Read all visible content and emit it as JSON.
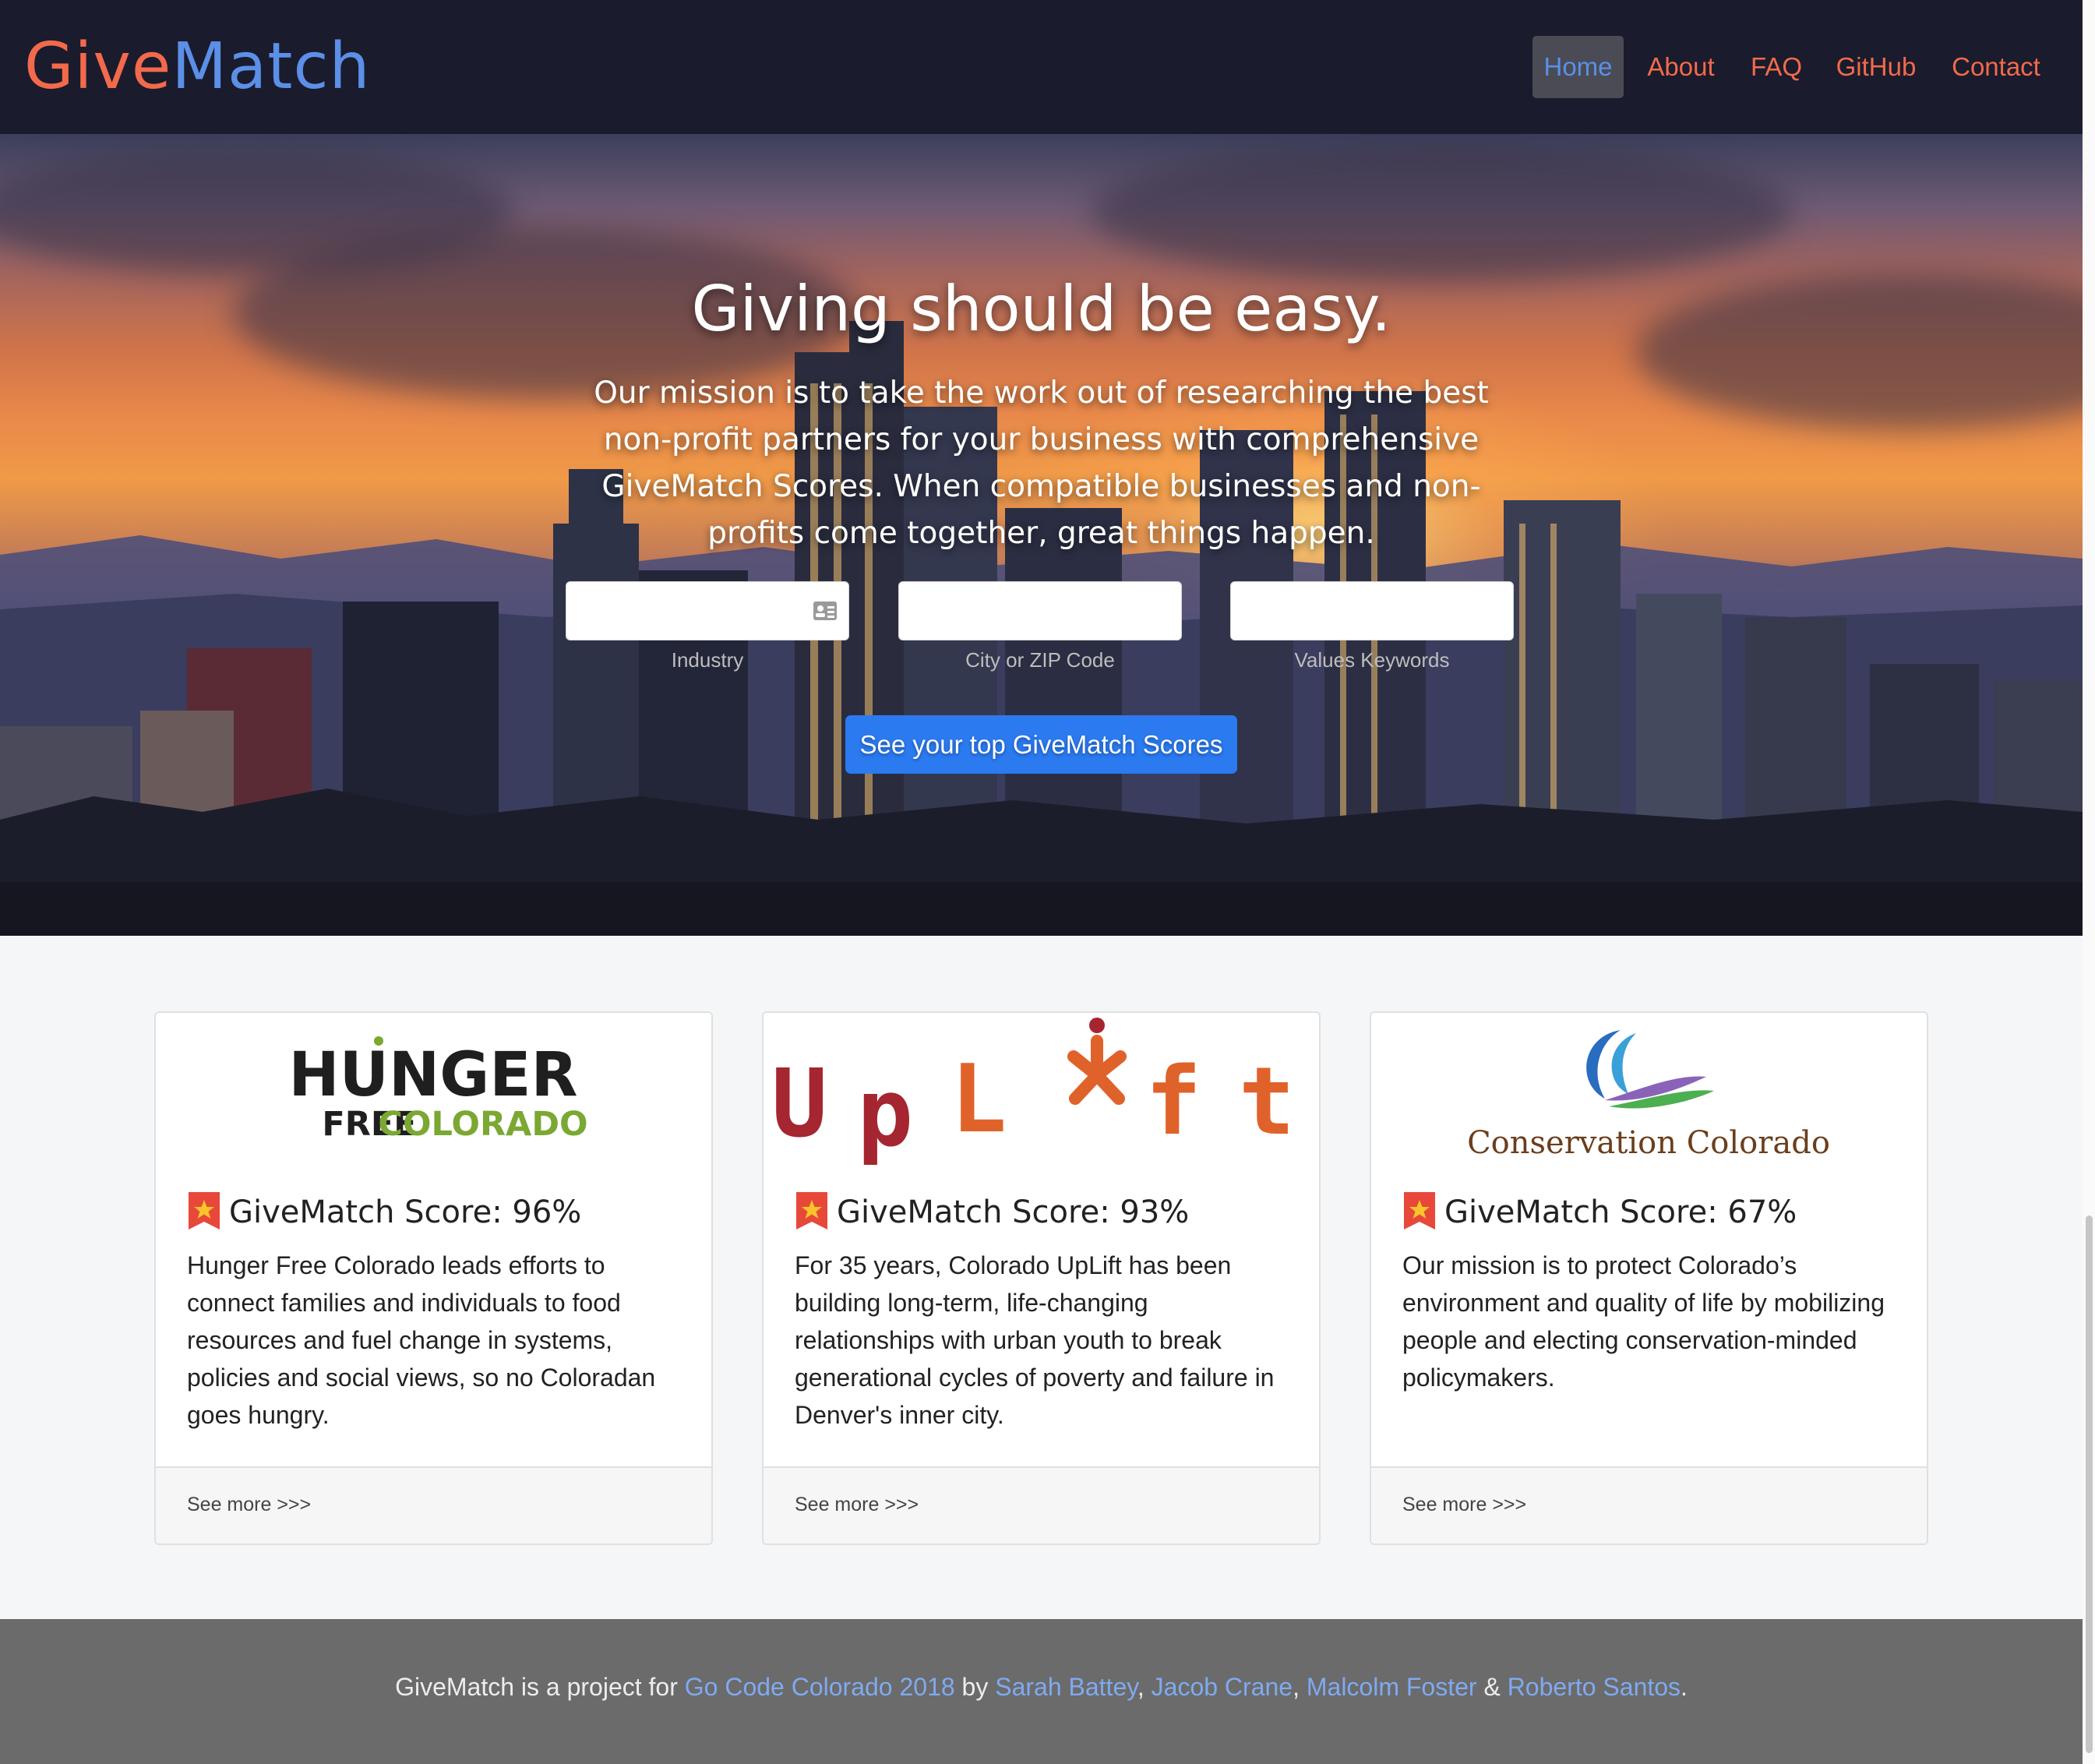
{
  "brand": {
    "part1": "Give",
    "part2": "Match"
  },
  "nav": {
    "items": [
      {
        "label": "Home",
        "active": true
      },
      {
        "label": "About",
        "active": false
      },
      {
        "label": "FAQ",
        "active": false
      },
      {
        "label": "GitHub",
        "active": false
      },
      {
        "label": "Contact",
        "active": false
      }
    ]
  },
  "hero": {
    "title": "Giving should be easy.",
    "text": "Our mission is to take the work out of researching the best non-profit partners for your business with comprehensive GiveMatch Scores. When compatible businesses and non-profits come together, great things happen.",
    "fields": [
      {
        "label": "Industry",
        "value": "",
        "placeholder": "",
        "icon": "contact-card-icon"
      },
      {
        "label": "City or ZIP Code",
        "value": "",
        "placeholder": ""
      },
      {
        "label": "Values Keywords",
        "value": "",
        "placeholder": ""
      }
    ],
    "cta_label": "See your top GiveMatch Scores"
  },
  "cards": [
    {
      "logo_line1": "HUNGER",
      "logo_line2a": "FREE",
      "logo_line2b": "COLORADO",
      "score": "GiveMatch Score: 96%",
      "description": "Hunger Free Colorado leads efforts to connect families and individuals to food resources and fuel change in systems, policies and social views, so no Coloradan goes hungry.",
      "link": "See more >>>"
    },
    {
      "logo_text": "UpLift",
      "score": "GiveMatch Score: 93%",
      "description": "For 35 years, Colorado UpLift has been building long-term, life-changing relationships with urban youth to break generational cycles of poverty and failure in Denver's inner city.",
      "link": "See more >>>"
    },
    {
      "logo_text": "Conservation Colorado",
      "score": "GiveMatch Score: 67%",
      "description": "Our mission is to protect Colorado’s environment and quality of life by mobilizing people and electing conservation-minded policymakers.",
      "link": "See more >>>"
    }
  ],
  "footer": {
    "prefix": "GiveMatch is a project for",
    "project_link": "Go Code Colorado 2018",
    "by": "by",
    "authors": [
      "Sarah Battey",
      "Jacob Crane",
      "Malcolm Foster",
      "Roberto Santos"
    ],
    "sep1": ",",
    "sep2": ",",
    "amp": "&",
    "end": "."
  },
  "colors": {
    "navbar_bg": "#1a1b2c",
    "brand_orange": "#f26a4b",
    "brand_blue": "#5b8fe8",
    "cta_blue": "#2b7af0",
    "footer_bg": "#6b6b6b",
    "link_blue": "#7faaf0"
  }
}
